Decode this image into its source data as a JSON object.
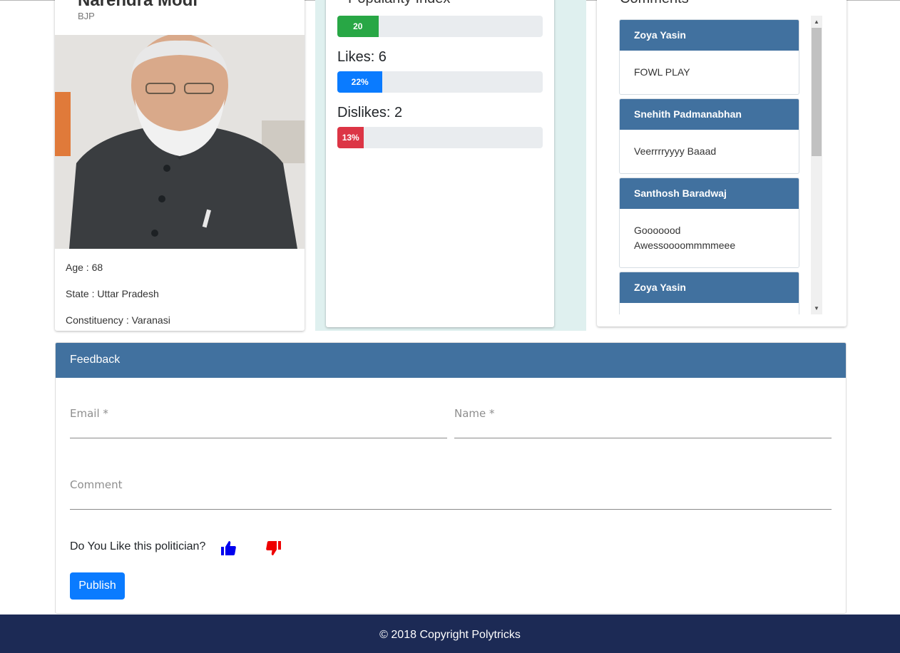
{
  "profile": {
    "name": "Narendra Modi",
    "party": "BJP",
    "age": "Age : 68",
    "state": "State : Uttar Pradesh",
    "constituency": "Constituency : Varanasi"
  },
  "popularity": {
    "title": "Popularity Index",
    "index_label": "20",
    "index_value": 20,
    "index_color": "#28a745",
    "likes_text": "Likes: 6",
    "likes_label": "22%",
    "likes_value": 22,
    "likes_color": "#0a7bff",
    "dislikes_text": "Dislikes: 2",
    "dislikes_label": "13%",
    "dislikes_value": 13,
    "dislikes_color": "#dc3545"
  },
  "comments": {
    "title": "Comments",
    "items": [
      {
        "author": "Zoya Yasin",
        "text": "FOWL PLAY"
      },
      {
        "author": "Snehith Padmanabhan",
        "text": "Veerrrryyyy Baaad"
      },
      {
        "author": "Santhosh Baradwaj",
        "text": "Gooooood Awessoooommmmeee"
      },
      {
        "author": "Zoya Yasin",
        "text": ""
      }
    ]
  },
  "feedback": {
    "header": "Feedback",
    "email_label": "Email *",
    "name_label": "Name *",
    "comment_label": "Comment",
    "question": "Do You Like this politician?",
    "like_icon": "thumbs-up-icon",
    "dislike_icon": "thumbs-down-icon",
    "like_color": "#0000ee",
    "dislike_color": "#ee0000",
    "publish_label": "Publish"
  },
  "footer": {
    "copyright": "© 2018 Copyright Polytricks"
  }
}
